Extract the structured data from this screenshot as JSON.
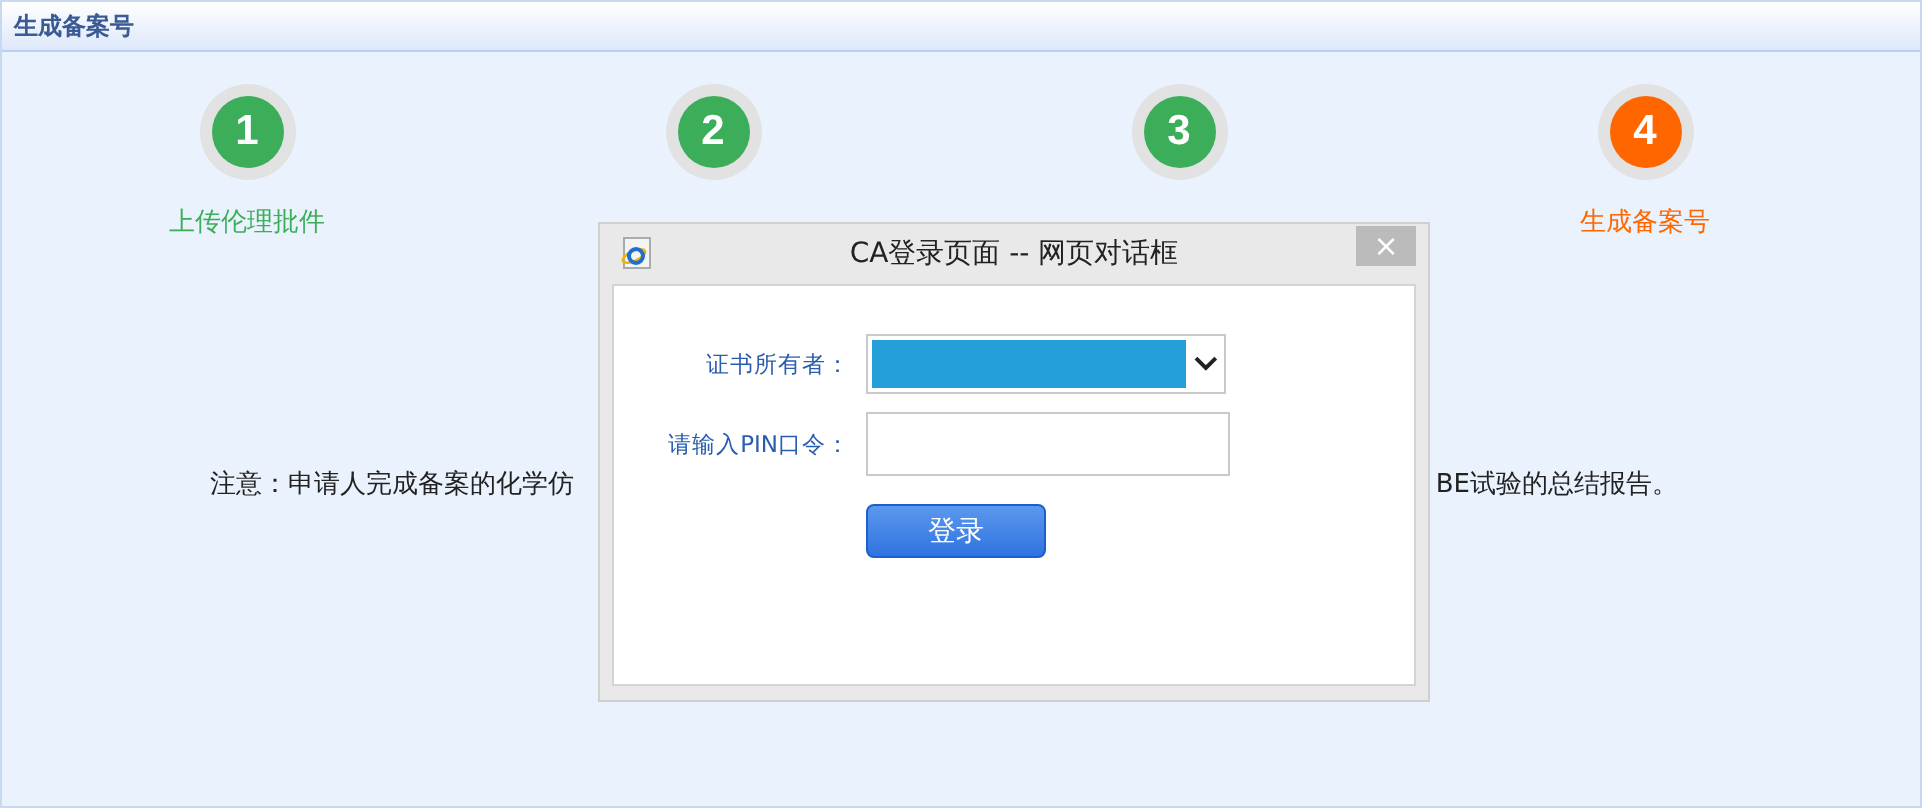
{
  "header": {
    "title": "生成备案号"
  },
  "steps": [
    {
      "number": "1",
      "label": "上传伦理批件",
      "current": false
    },
    {
      "number": "2",
      "current": false
    },
    {
      "number": "3",
      "current": false
    },
    {
      "number": "4",
      "label": "生成备案号",
      "current": true
    }
  ],
  "notice": {
    "left_part": "注意：申请人完成备案的化学仿",
    "right_part": "BE试验的总结报告。"
  },
  "dialog": {
    "title": "CA登录页面 -- 网页对话框",
    "close": "×",
    "fields": [
      {
        "kind": "select",
        "label": "证书所有者："
      },
      {
        "kind": "password",
        "label": "请输入PIN口令："
      }
    ],
    "button": "登录"
  }
}
